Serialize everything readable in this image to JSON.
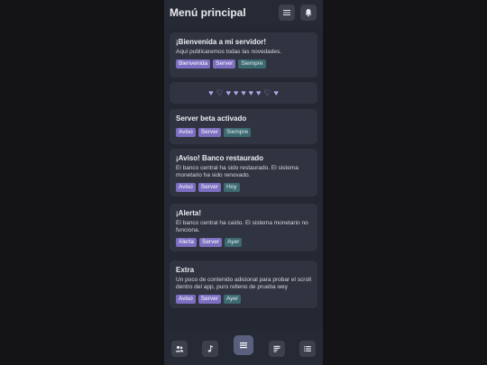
{
  "header": {
    "title": "Menú principal",
    "menu_icon": "menu-icon",
    "bell_icon": "bell-icon"
  },
  "cards": [
    {
      "title": "¡Bienvenida a mi servidor!",
      "body": "Aquí publicaremos todas las novedades.",
      "tags": [
        "Bienvenida",
        "Server",
        "Siempre"
      ]
    },
    {
      "title": "Server beta activado",
      "body": "",
      "tags": [
        "Aviso",
        "Server",
        "Siempre"
      ]
    },
    {
      "title": "¡Aviso! Banco restaurado",
      "body": "El banco central ha sido restaurado. El sistema monetario ha sido renovado.",
      "tags": [
        "Aviso",
        "Server",
        "Hoy"
      ]
    },
    {
      "title": "¡Alerta!",
      "body": "El banco central ha caído. El sistema monetario no funciona.",
      "tags": [
        "Alerta",
        "Server",
        "Ayer"
      ]
    },
    {
      "title": "Extra",
      "body": "Un poco de contenido adicional para probar el scroll dentro del app, puro relleno de prueba wey",
      "tags": [
        "Aviso",
        "Server",
        "Ayer"
      ]
    }
  ],
  "hearts": [
    "♥",
    "♡",
    "♥",
    "♥",
    "♥",
    "♥",
    "♥",
    "♡",
    "♥"
  ],
  "nav": [
    {
      "icon": "people-icon"
    },
    {
      "icon": "music-note-icon"
    },
    {
      "icon": "menu-icon",
      "active": true
    },
    {
      "icon": "news-icon"
    },
    {
      "icon": "list-icon"
    }
  ],
  "colors": {
    "background": "#141416",
    "panel": "#242833",
    "card": "#2f3440",
    "tag_purple": "#7c6fc2",
    "tag_teal": "#3d6970",
    "heart": "#b0a4e6"
  }
}
